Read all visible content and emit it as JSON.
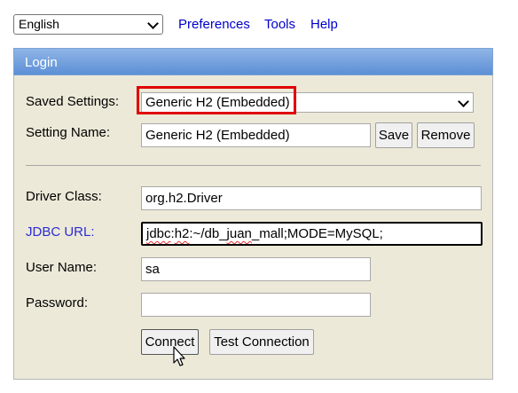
{
  "topbar": {
    "language": "English",
    "links": [
      "Preferences",
      "Tools",
      "Help"
    ]
  },
  "panel": {
    "title": "Login",
    "saved_settings": {
      "label": "Saved Settings:",
      "value": "Generic H2 (Embedded)"
    },
    "setting_name": {
      "label": "Setting Name:",
      "value": "Generic H2 (Embedded)"
    },
    "save_label": "Save",
    "remove_label": "Remove",
    "driver_class": {
      "label": "Driver Class:",
      "value": "org.h2.Driver"
    },
    "jdbc_url": {
      "label": "JDBC URL:",
      "value_parts": [
        "jdbc",
        ":",
        "h2",
        ":~/db_",
        "juan",
        "_mall;MODE=MySQL;"
      ]
    },
    "user_name": {
      "label": "User Name:",
      "value": "sa"
    },
    "password": {
      "label": "Password:",
      "value": ""
    },
    "connect_label": "Connect",
    "test_connection_label": "Test Connection"
  },
  "colors": {
    "link": "#0000cc",
    "header_gradient_top": "#8fb5e6",
    "header_gradient_bottom": "#5c8fd6",
    "panel_bg": "#ece9d8",
    "highlight": "#e00000"
  }
}
